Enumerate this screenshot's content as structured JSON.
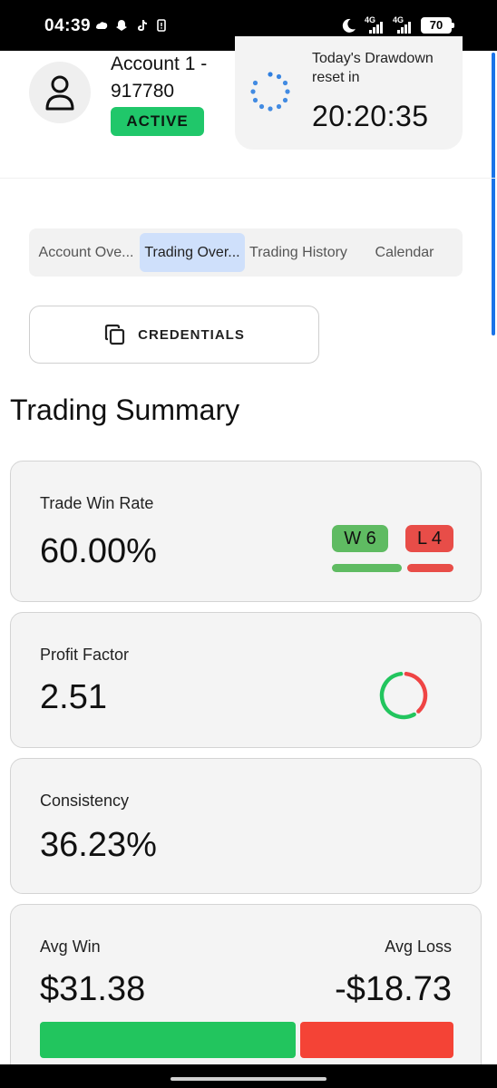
{
  "status_bar": {
    "time": "04:39",
    "network_1": "4G",
    "network_2": "4G",
    "battery": "70"
  },
  "account": {
    "name": "Account 1 - 917780",
    "status": "ACTIVE"
  },
  "drawdown": {
    "label": "Today's Drawdown reset in",
    "countdown": "20:20:35"
  },
  "tabs": [
    {
      "label": "Account Ove...",
      "selected": false
    },
    {
      "label": "Trading Over...",
      "selected": true
    },
    {
      "label": "Trading History",
      "selected": false
    },
    {
      "label": "Calendar",
      "selected": false
    }
  ],
  "credentials": {
    "label": "CREDENTIALS"
  },
  "summary": {
    "title": "Trading Summary",
    "win_rate": {
      "label": "Trade Win Rate",
      "value": "60.00%",
      "wins_label": "W 6",
      "losses_label": "L 4",
      "wins": 6,
      "losses": 4
    },
    "profit_factor": {
      "label": "Profit Factor",
      "value": "2.51",
      "ring_fraction_green": 0.6
    },
    "consistency": {
      "label": "Consistency",
      "value": "36.23%"
    },
    "avg": {
      "win_label": "Avg Win",
      "win_value": "$31.38",
      "loss_label": "Avg Loss",
      "loss_value": "-$18.73",
      "win_amount": 31.38,
      "loss_amount": 18.73
    }
  },
  "colors": {
    "accent_blue": "#1a73e8",
    "active_green": "#20c76a",
    "win_green": "#5fbb62",
    "loss_red": "#e84d48",
    "tab_selected": "#cfe0fb"
  }
}
